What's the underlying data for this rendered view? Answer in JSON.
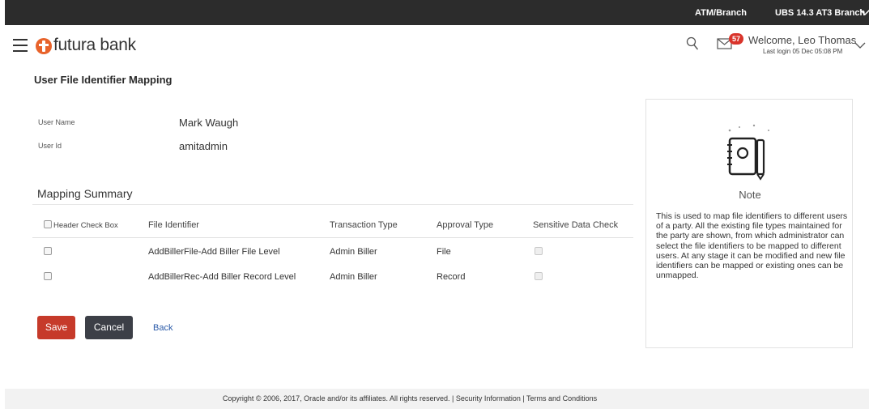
{
  "topbar": {
    "atm_branch_label": "ATM/Branch",
    "branch_label": "UBS 14.3 AT3 Branch"
  },
  "header": {
    "logo_text": "futura bank",
    "notification_count": "57",
    "welcome_text": "Welcome, Leo Thomas",
    "last_login": "Last login 05 Dec 05:08 PM"
  },
  "page": {
    "title": "User File Identifier Mapping"
  },
  "user": {
    "name_label": "User Name",
    "name_value": "Mark Waugh",
    "id_label": "User Id",
    "id_value": "amitadmin"
  },
  "summary": {
    "title": "Mapping Summary",
    "columns": {
      "header_check": "Header Check Box",
      "file_identifier": "File Identifier",
      "transaction_type": "Transaction Type",
      "approval_type": "Approval Type",
      "sensitive_data": "Sensitive Data Check"
    },
    "rows": [
      {
        "file_identifier": "AddBillerFile-Add Biller File Level",
        "transaction_type": "Admin Biller",
        "approval_type": "File"
      },
      {
        "file_identifier": "AddBillerRec-Add Biller Record Level",
        "transaction_type": "Admin Biller",
        "approval_type": "Record"
      }
    ]
  },
  "actions": {
    "save": "Save",
    "cancel": "Cancel",
    "back": "Back"
  },
  "note": {
    "title": "Note",
    "text": "This is used to map file identifiers to different users of a party. All the existing file types maintained for the party are shown, from which administrator can select the file identifiers to be mapped to different users. At any stage it can be modified and new file identifiers can be mapped or existing ones can be unmapped."
  },
  "footer": {
    "text": "Copyright © 2006, 2017, Oracle and/or its affiliates. All rights reserved. | Security Information | Terms and Conditions"
  },
  "colors": {
    "topbar_bg": "#2c2c2c",
    "brand": "#e8632b",
    "save_button": "#c63a2a",
    "cancel_button": "#3c3f47",
    "badge": "#d9342b",
    "link": "#2a5aa8"
  },
  "icons": [
    "menu-icon",
    "futura-logo-icon",
    "search-icon",
    "mail-icon",
    "chevron-down-icon",
    "notebook-icon"
  ]
}
